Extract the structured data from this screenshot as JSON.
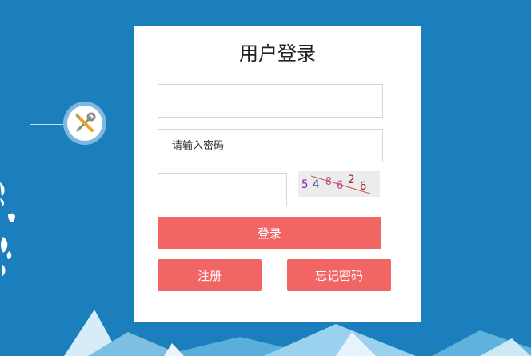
{
  "login_form": {
    "title": "用户登录",
    "username": {
      "value": "",
      "placeholder": ""
    },
    "password": {
      "value": "",
      "placeholder": "请输入密码"
    },
    "captcha": {
      "value": "",
      "placeholder": "",
      "image_text": "548626"
    },
    "login_label": "登录",
    "register_label": "注册",
    "forgot_password_label": "忘记密码"
  },
  "decorations": {
    "tool_icon": "wrench-screwdriver-icon",
    "background_color": "#1b7fbd",
    "button_color": "#f26565"
  }
}
